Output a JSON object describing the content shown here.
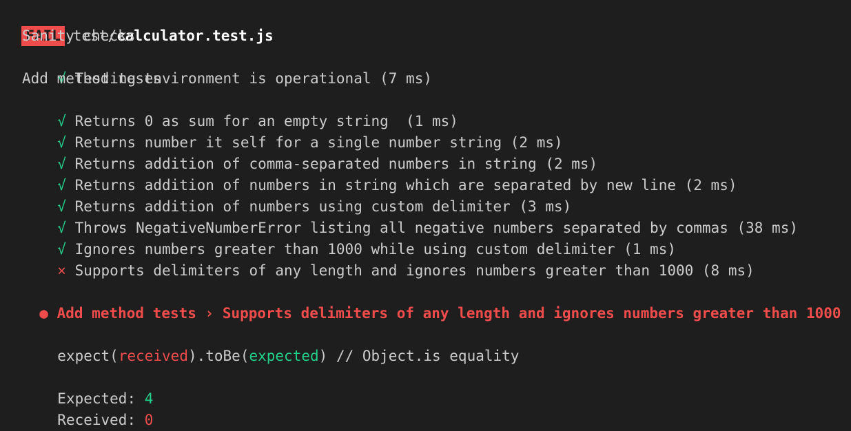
{
  "header": {
    "status_badge": "FAIL",
    "path_dir": "test/",
    "path_file": "calculator.test.js"
  },
  "suites": [
    {
      "name": "Sanity checks",
      "tests": [
        {
          "mark": "√",
          "label": "Testing environment is operational (7 ms)"
        }
      ]
    },
    {
      "name": "Add method tests",
      "tests": [
        {
          "mark": "√",
          "label": "Returns 0 as sum for an empty string  (1 ms)"
        },
        {
          "mark": "√",
          "label": "Returns number it self for a single number string (2 ms)"
        },
        {
          "mark": "√",
          "label": "Returns addition of comma-separated numbers in string (2 ms)"
        },
        {
          "mark": "√",
          "label": "Returns addition of numbers in string which are separated by new line (2 ms)"
        },
        {
          "mark": "√",
          "label": "Returns addition of numbers using custom delimiter (3 ms)"
        },
        {
          "mark": "√",
          "label": "Throws NegativeNumberError listing all negative numbers separated by commas (38 ms)"
        },
        {
          "mark": "√",
          "label": "Ignores numbers greater than 1000 while using custom delimiter (1 ms)"
        },
        {
          "mark": "×",
          "label": "Supports delimiters of any length and ignores numbers greater than 1000 (8 ms)"
        }
      ]
    }
  ],
  "failure": {
    "bullet": "●",
    "title": "Add method tests › Supports delimiters of any length and ignores numbers greater than 1000",
    "assert_prefix": "expect(",
    "assert_received": "received",
    "assert_mid": ").toBe(",
    "assert_expected": "expected",
    "assert_suffix": ") // Object.is equality",
    "expected_label": "Expected: ",
    "expected_value": "4",
    "received_label": "Received: ",
    "received_value": "0"
  },
  "colors": {
    "background": "#1e1e1e",
    "text": "#cccccc",
    "pass": "#23d18b",
    "fail": "#f14c4c"
  }
}
